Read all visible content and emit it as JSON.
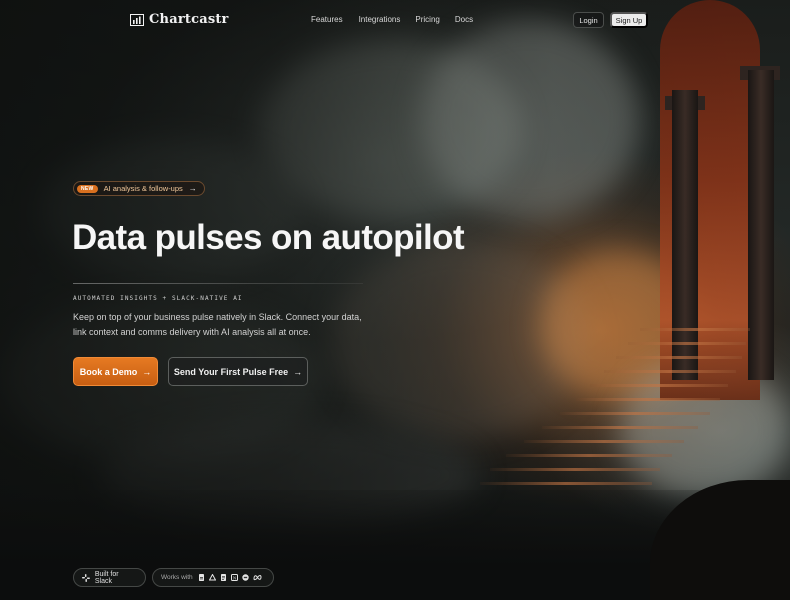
{
  "nav": {
    "brand": "Chartcastr",
    "links": [
      "Features",
      "Integrations",
      "Pricing",
      "Docs"
    ],
    "login": "Login",
    "signup": "Sign Up"
  },
  "announcement": {
    "badge": "NEW",
    "text": "AI analysis & follow-ups",
    "arrow": "→"
  },
  "hero": {
    "headline": "Data pulses on autopilot",
    "eyebrow": "AUTOMATED INSIGHTS + SLACK-NATIVE AI",
    "subtext": "Keep on top of your business pulse natively in Slack. Connect your data, link context and comms delivery with AI analysis all at once."
  },
  "cta": {
    "primary": "Book a Demo",
    "secondary": "Send Your First Pulse Free",
    "arrow": "→"
  },
  "footer": {
    "slack_chip": "Built for Slack",
    "works_with": "Works with",
    "integration_icons": [
      "sheets-icon",
      "drive-icon",
      "docs-icon",
      "notion-icon",
      "stripe-icon",
      "meta-icon"
    ]
  },
  "colors": {
    "accent": "#e67a22",
    "badge": "#d9701f",
    "pill_text": "#f0c79a"
  }
}
